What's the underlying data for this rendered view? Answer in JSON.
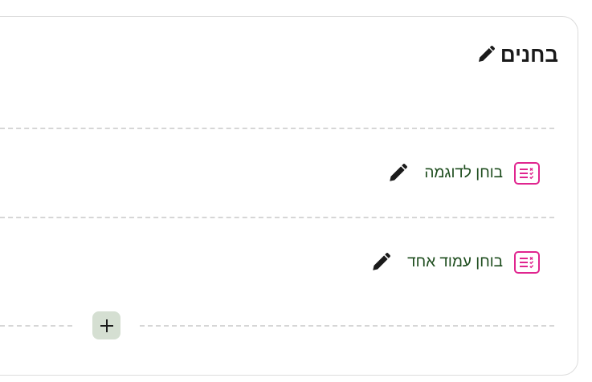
{
  "section": {
    "title": "בחנים",
    "edit_icon": "pencil-icon"
  },
  "activities": [
    {
      "name": "בוחן לדוגמה",
      "icon": "quiz-icon",
      "edit_icon": "pencil-icon"
    },
    {
      "name": "בוחן עמוד אחד",
      "icon": "quiz-icon",
      "edit_icon": "pencil-icon"
    }
  ],
  "add_button": {
    "label": "+",
    "icon": "plus-icon"
  },
  "colors": {
    "quiz_icon": "#e0258f",
    "activity_text": "#1e4d1e",
    "add_button_bg": "#d5dfd2",
    "title_text": "#1a1a1a"
  }
}
